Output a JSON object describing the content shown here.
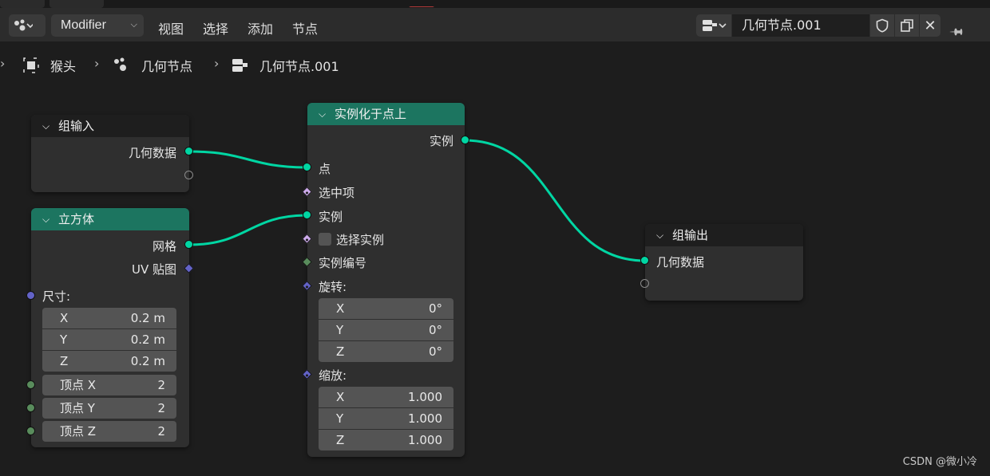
{
  "header": {
    "editor_icon": "node-editor-icon",
    "modifier_label": "Modifier",
    "menus": [
      "视图",
      "选择",
      "添加",
      "节点"
    ],
    "tree_name": "几何节点.001"
  },
  "breadcrumb": {
    "items": [
      {
        "icon": "mesh-object-icon",
        "label": "猴头"
      },
      {
        "icon": "geometry-nodes-icon",
        "label": "几何节点"
      },
      {
        "icon": "node-tree-icon",
        "label": "几何节点.001"
      }
    ]
  },
  "nodes": {
    "group_input": {
      "title": "组输入",
      "outputs": [
        "几何数据"
      ]
    },
    "cube": {
      "title": "立方体",
      "outputs": [
        "网格",
        "UV 贴图"
      ],
      "size_label": "尺寸:",
      "size": [
        {
          "axis": "X",
          "value": "0.2 m"
        },
        {
          "axis": "Y",
          "value": "0.2 m"
        },
        {
          "axis": "Z",
          "value": "0.2 m"
        }
      ],
      "vertices": [
        {
          "label": "顶点 X",
          "value": "2"
        },
        {
          "label": "顶点 Y",
          "value": "2"
        },
        {
          "label": "顶点 Z",
          "value": "2"
        }
      ]
    },
    "instance_on_points": {
      "title": "实例化于点上",
      "output": "实例",
      "inputs": {
        "points": "点",
        "selection": "选中项",
        "instance": "实例",
        "pick_instance": "选择实例",
        "instance_index": "实例编号",
        "rotation": "旋转:",
        "scale": "缩放:"
      },
      "rotation": [
        {
          "axis": "X",
          "value": "0°"
        },
        {
          "axis": "Y",
          "value": "0°"
        },
        {
          "axis": "Z",
          "value": "0°"
        }
      ],
      "scale": [
        {
          "axis": "X",
          "value": "1.000"
        },
        {
          "axis": "Y",
          "value": "1.000"
        },
        {
          "axis": "Z",
          "value": "1.000"
        }
      ]
    },
    "group_output": {
      "title": "组输出",
      "inputs": [
        "几何数据"
      ]
    }
  },
  "colors": {
    "geometry_socket": "#00d6a3",
    "vector_socket": "#6363c7",
    "integer_socket": "#598c5c",
    "boolean_socket": "#ccaaea",
    "node_header_geometry": "#1c7560",
    "wire": "#00d6a3"
  },
  "watermark": "CSDN @微小冷"
}
